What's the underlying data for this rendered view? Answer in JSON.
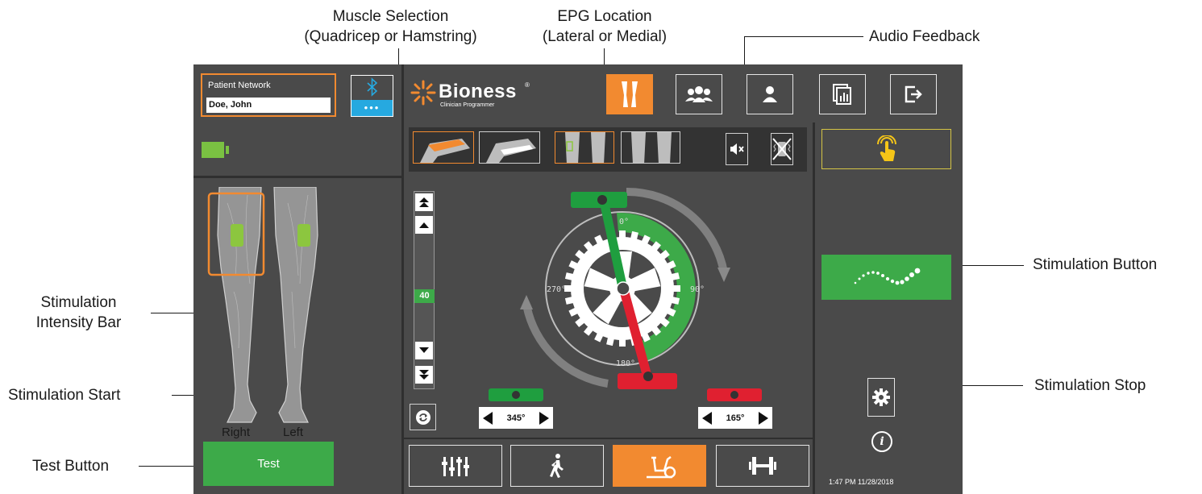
{
  "callouts": {
    "muscle_selection": [
      "Muscle Selection",
      "(Quadricep or Hamstring)"
    ],
    "epg_location": [
      "EPG Location",
      "(Lateral or Medial)"
    ],
    "audio_feedback": "Audio Feedback",
    "stimulation_button": "Stimulation Button",
    "stimulation_intensity_bar": [
      "Stimulation",
      "Intensity Bar"
    ],
    "stimulation_start": "Stimulation Start",
    "stimulation_stop": "Stimulation Stop",
    "test_button": "Test Button"
  },
  "patient_network": {
    "label": "Patient Network",
    "value": "Doe, John"
  },
  "bluetooth": {
    "icon": "bluetooth-icon",
    "dots": "•••"
  },
  "battery": {
    "icon": "battery-icon",
    "color": "#7ac142"
  },
  "legs": {
    "right_label": "Right",
    "left_label": "Left"
  },
  "test_button": {
    "label": "Test",
    "color": "#3daa49"
  },
  "logo": {
    "name": "Bioness",
    "subtitle": "Clinician Programmer",
    "registered": "®"
  },
  "top_nav": [
    {
      "icon": "legs-icon",
      "active": true
    },
    {
      "icon": "group-icon",
      "active": false
    },
    {
      "icon": "user-icon",
      "active": false
    },
    {
      "icon": "report-icon",
      "active": false
    },
    {
      "icon": "exit-icon",
      "active": false
    }
  ],
  "muscle_selection": {
    "options": [
      "Quadricep",
      "Hamstring"
    ],
    "selected": "Quadricep"
  },
  "epg_location": {
    "options": [
      "Lateral",
      "Medial"
    ],
    "selected": "Lateral"
  },
  "audio": {
    "icon": "mute-icon"
  },
  "vibration": {
    "icon": "vibration-off-icon"
  },
  "intensity": {
    "value": "40",
    "up_fast": "double-up-icon",
    "up": "up-icon",
    "down": "down-icon",
    "down_fast": "double-down-icon"
  },
  "cycle": {
    "angles": {
      "top": "0°",
      "right": "90°",
      "bottom": "180°",
      "left": "270°"
    },
    "start_angle": "345°",
    "stop_angle": "165°",
    "start_color": "#1f9e3f",
    "stop_color": "#e02030",
    "arc_color": "#3daa49"
  },
  "bottom_nav": [
    {
      "icon": "sliders-icon",
      "active": false
    },
    {
      "icon": "walking-icon",
      "active": false
    },
    {
      "icon": "bike-icon",
      "active": true
    },
    {
      "icon": "dumbbell-icon",
      "active": false
    }
  ],
  "right_panel": {
    "touch_icon": "touch-icon",
    "stim_icon": "stimulation-wave-icon",
    "gear_icon": "gear-icon",
    "info_label": "i",
    "timestamp": "1:47 PM 11/28/2018"
  },
  "colors": {
    "accent": "#f28a30",
    "screen_bg": "#4a4a4a",
    "green": "#3daa49",
    "bt_blue": "#26a9e0"
  }
}
